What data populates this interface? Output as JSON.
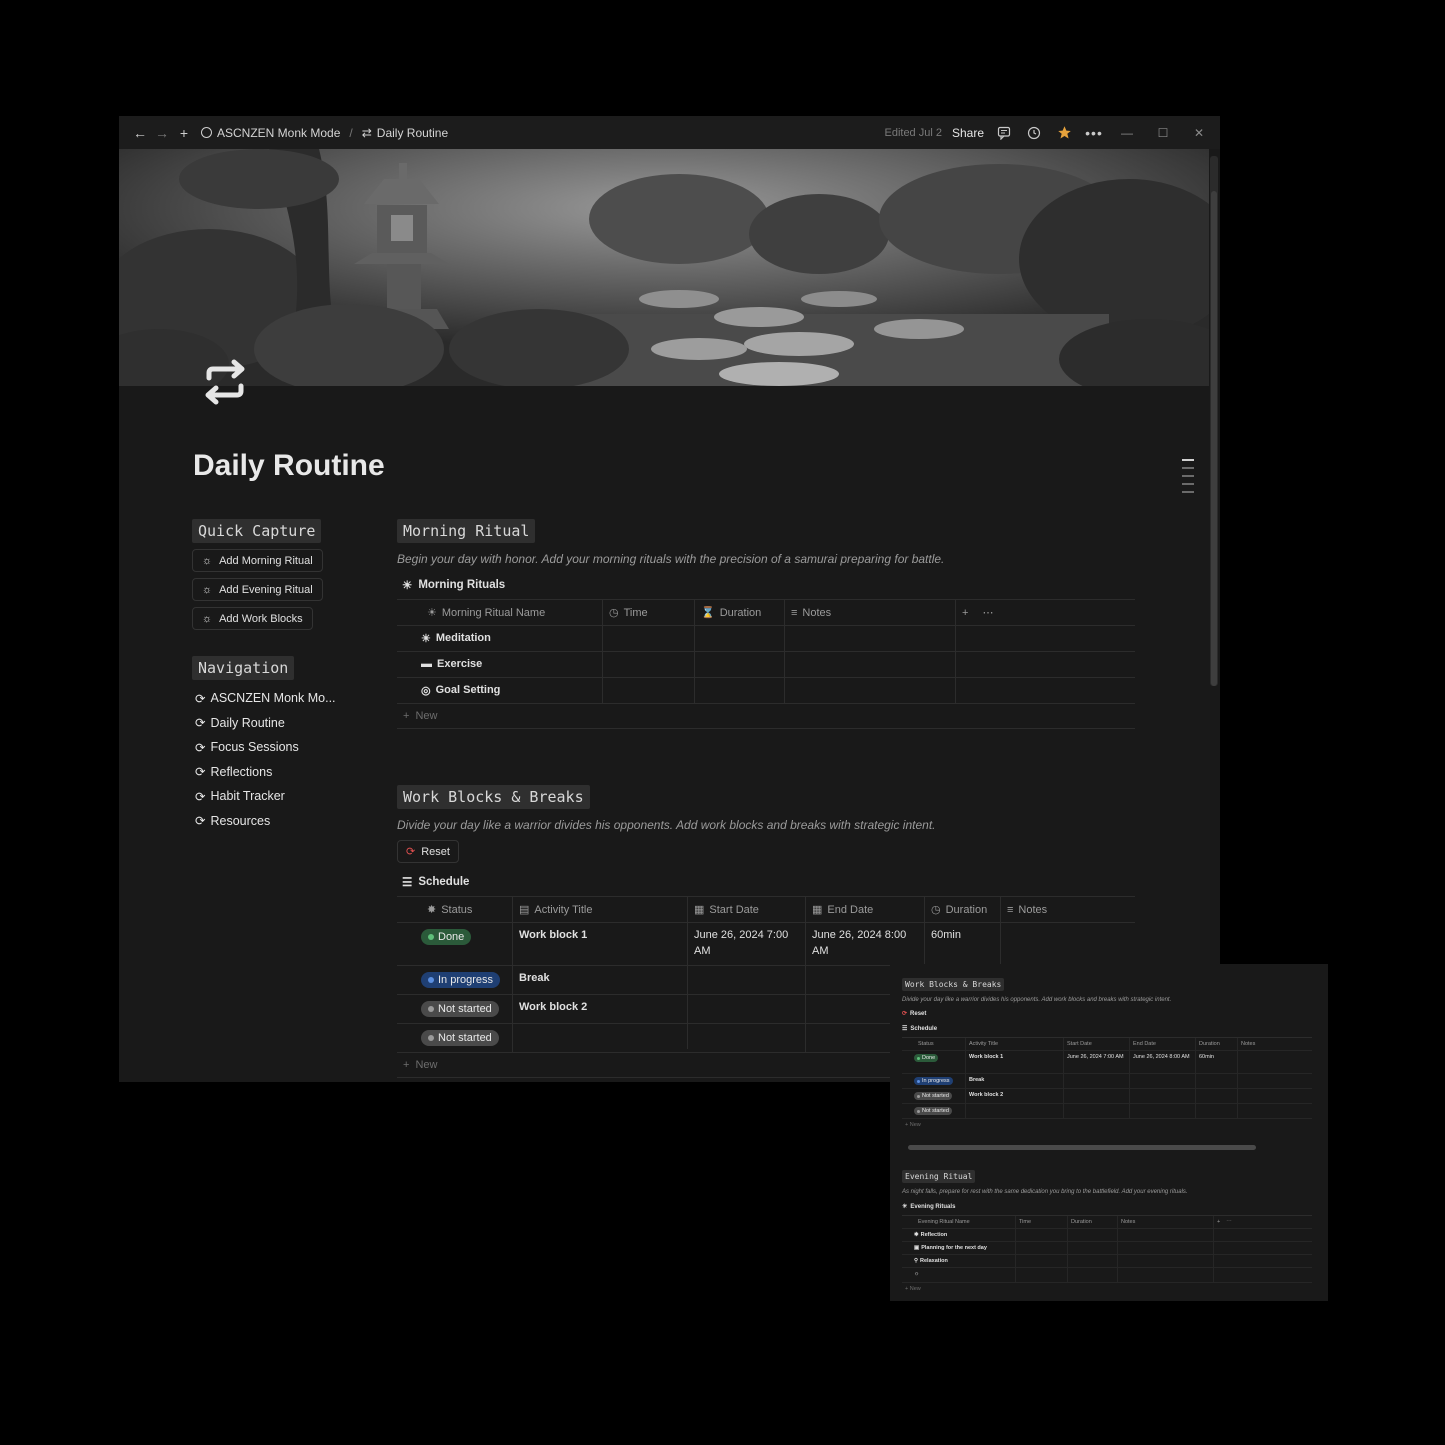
{
  "topbar": {
    "workspace": "ASCNZEN Monk Mode",
    "separator": "/",
    "page": "Daily Routine",
    "edited": "Edited Jul 2",
    "share": "Share"
  },
  "colors": {
    "bg": "#191919",
    "done": "#2b5a3a",
    "in_progress": "#1f3f73",
    "not_started": "#4a4a4a",
    "star": "#e6a23c"
  },
  "page": {
    "title": "Daily Routine"
  },
  "quick_capture": {
    "heading": "Quick Capture",
    "buttons": [
      "Add Morning Ritual",
      "Add Evening Ritual",
      "Add Work Blocks"
    ]
  },
  "navigation": {
    "heading": "Navigation",
    "items": [
      "ASCNZEN Monk Mo...",
      "Daily Routine",
      "Focus Sessions",
      "Reflections",
      "Habit Tracker",
      "Resources"
    ]
  },
  "morning": {
    "heading": "Morning Ritual",
    "desc": "Begin your day with honor. Add your morning rituals with the precision of a samurai preparing for battle.",
    "db_name": "Morning Rituals",
    "columns": [
      "Morning Ritual Name",
      "Time",
      "Duration",
      "Notes"
    ],
    "rows": [
      "Meditation",
      "Exercise",
      "Goal Setting"
    ],
    "new": "New"
  },
  "work": {
    "heading": "Work Blocks & Breaks",
    "desc": "Divide your day like a warrior divides his opponents. Add work blocks and breaks with strategic intent.",
    "reset": "Reset",
    "db_name": "Schedule",
    "columns": [
      "Status",
      "Activity Title",
      "Start Date",
      "End Date",
      "Duration",
      "Notes"
    ],
    "rows": [
      {
        "status": "Done",
        "title": "Work block 1",
        "start": "June 26, 2024 7:00 AM",
        "end": "June 26, 2024 8:00 AM",
        "duration": "60min"
      },
      {
        "status": "In progress",
        "title": "Break",
        "start": "",
        "end": "",
        "duration": ""
      },
      {
        "status": "Not started",
        "title": "Work block 2",
        "start": "",
        "end": "",
        "duration": ""
      },
      {
        "status": "Not started",
        "title": "",
        "start": "",
        "end": "",
        "duration": ""
      }
    ],
    "new": "New"
  },
  "evening": {
    "heading": "Evening Ritual",
    "desc": "As night falls, prepare for rest with the same dedication you bring to the battlefield. Add your evening rituals.",
    "db_name": "Evening Rituals",
    "columns": [
      "Evening Ritual Name",
      "Time",
      "Duration",
      "Notes"
    ],
    "rows": [
      "Reflection",
      "Planning for the next day",
      "Relaxation",
      ""
    ],
    "new": "New"
  }
}
